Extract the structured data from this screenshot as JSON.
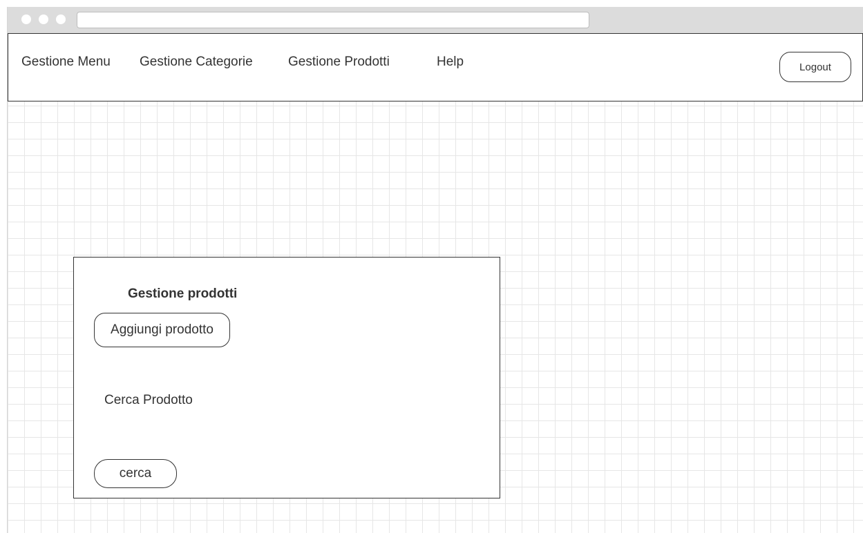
{
  "browser": {
    "address": ""
  },
  "navbar": {
    "links": [
      {
        "label": "Gestione Menu"
      },
      {
        "label": "Gestione Categorie"
      },
      {
        "label": "Gestione Prodotti"
      },
      {
        "label": "Help"
      }
    ],
    "logout_label": "Logout"
  },
  "panel": {
    "title": "Gestione prodotti",
    "add_button_label": "Aggiungi prodotto",
    "search_label": "Cerca Prodotto",
    "search_button_label": "cerca"
  },
  "colors": {
    "text": "#333333",
    "border": "#333333",
    "grid": "#e6e6e6",
    "titlebar": "#dcdcdc"
  }
}
